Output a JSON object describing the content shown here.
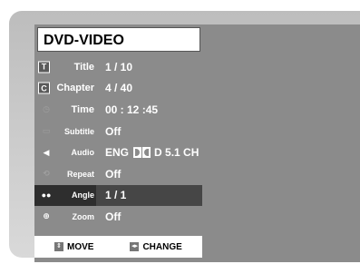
{
  "header": {
    "title": "DVD-VIDEO"
  },
  "menu": {
    "items": [
      {
        "icon": "title-icon",
        "glyph": "T",
        "label": "Title",
        "value": "1 / 10"
      },
      {
        "icon": "chapter-icon",
        "glyph": "C",
        "label": "Chapter",
        "value": "4 / 40"
      },
      {
        "icon": "time-icon",
        "glyph": "◷",
        "label": "Time",
        "value": "00 : 12 :45"
      },
      {
        "icon": "subtitle-icon",
        "glyph": "▭",
        "label": "Subtitle",
        "value": "Off"
      },
      {
        "icon": "audio-icon",
        "glyph": "◀",
        "label": "Audio",
        "value_prefix": "ENG",
        "value_suffix": "D 5.1 CH"
      },
      {
        "icon": "repeat-icon",
        "glyph": "⟲",
        "label": "Repeat",
        "value": "Off"
      },
      {
        "icon": "angle-icon",
        "glyph": "●●",
        "label": "Angle",
        "value": "1 / 1"
      },
      {
        "icon": "zoom-icon",
        "glyph": "⊕",
        "label": "Zoom",
        "value": "Off"
      }
    ],
    "selected_index": 6
  },
  "footer": {
    "move_key": "⇕",
    "move_label": "MOVE",
    "change_key": "◂▸",
    "change_label": "CHANGE"
  }
}
